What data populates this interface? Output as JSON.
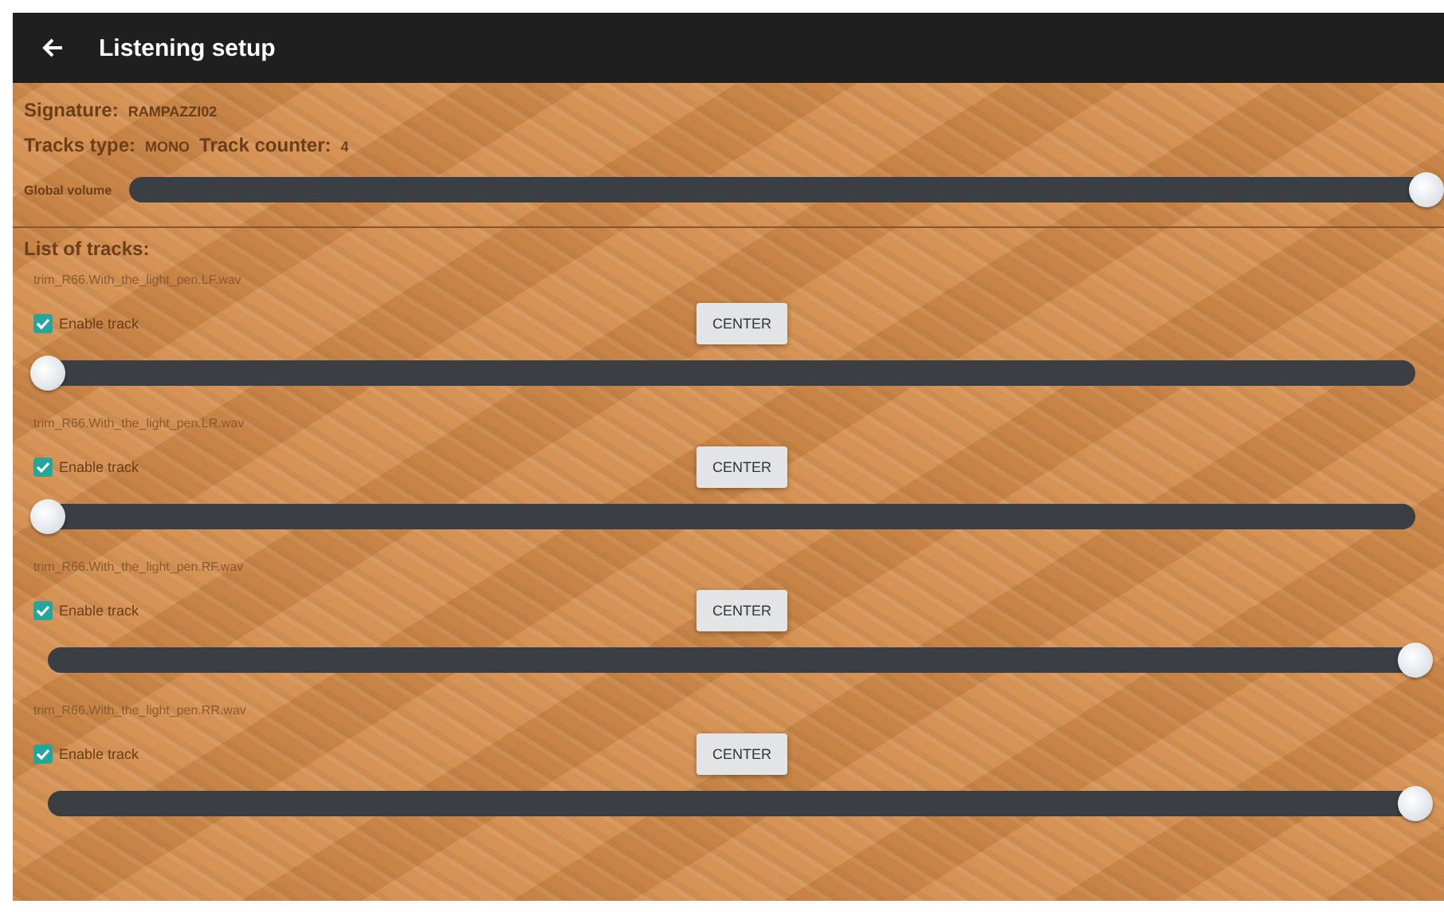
{
  "app_bar": {
    "title": "Listening setup"
  },
  "info": {
    "signature_label": "Signature:",
    "signature": "RAMPAZZI02",
    "tracks_type_label": "Tracks type:",
    "tracks_type": "MONO",
    "track_counter_label": "Track counter:",
    "track_counter": "4"
  },
  "global_volume": {
    "label": "Global volume",
    "level": 1
  },
  "list_heading": "List of tracks:",
  "tracks": [
    {
      "file": "trim_R66.With_the_light_pen.LF.wav",
      "enable_label": "Enable track",
      "checked": true,
      "button": "CENTER",
      "level": 0
    },
    {
      "file": "trim_R66.With_the_light_pen.LR.wav",
      "enable_label": "Enable track",
      "checked": true,
      "button": "CENTER",
      "level": 0
    },
    {
      "file": "trim_R66.With_the_light_pen.RF.wav",
      "enable_label": "Enable track",
      "checked": true,
      "button": "CENTER",
      "level": 1
    },
    {
      "file": "trim_R66.With_the_light_pen.RR.wav",
      "enable_label": "Enable track",
      "checked": true,
      "button": "CENTER",
      "level": 1
    }
  ]
}
